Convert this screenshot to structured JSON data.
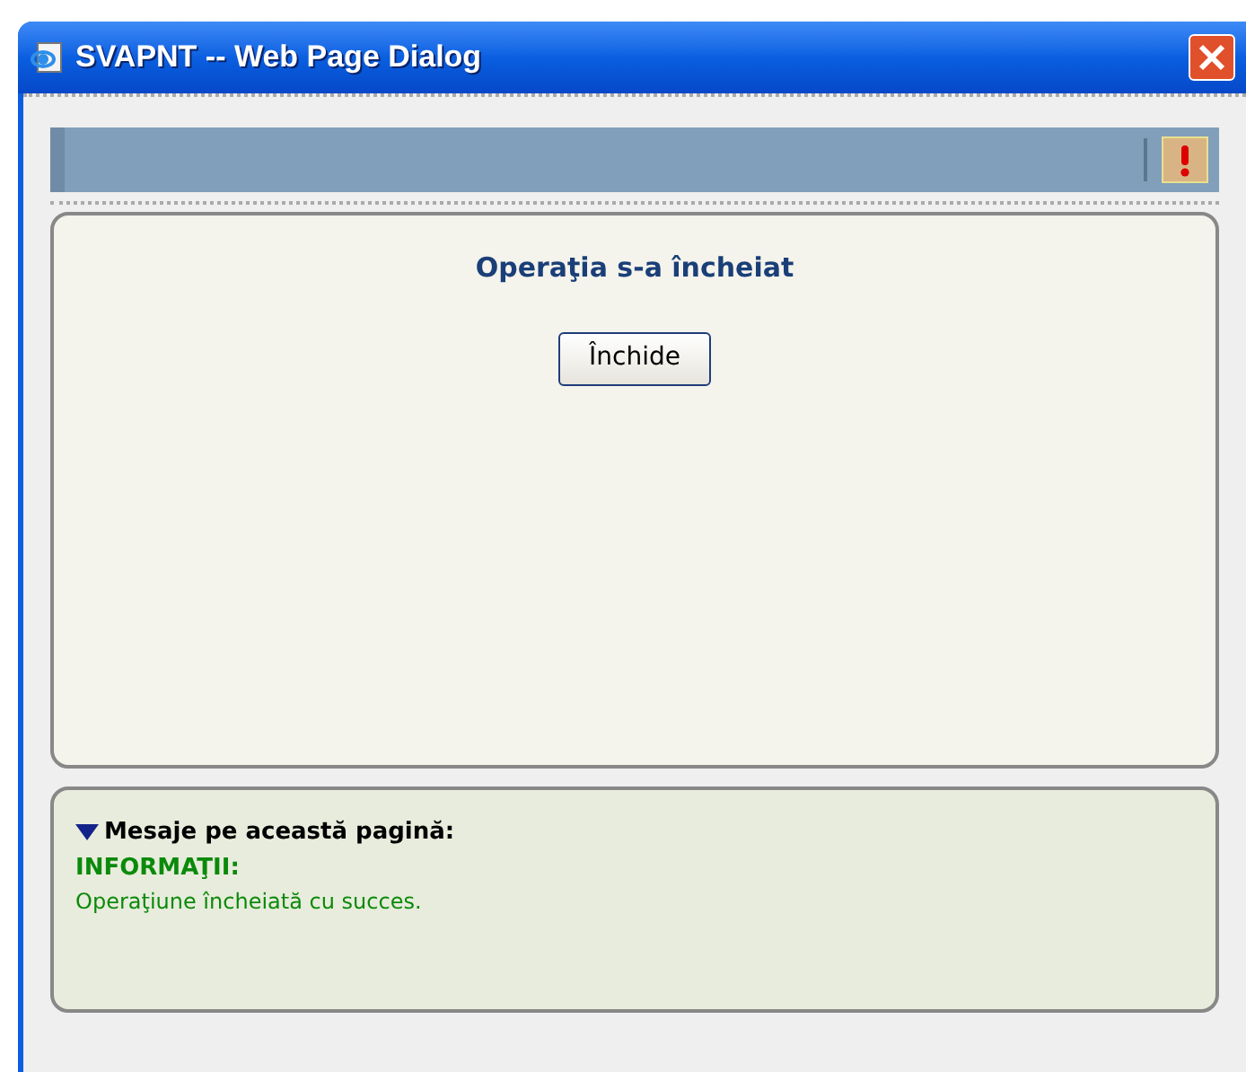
{
  "window": {
    "title": "SVAPNT -- Web Page Dialog"
  },
  "heading": "Operaţia s-a încheiat",
  "buttons": [
    "Închide"
  ],
  "messages": {
    "expanded": true,
    "title": "Mesaje pe această pagină:",
    "category": "INFORMAŢII:",
    "text": "Operaţiune încheiată cu succes."
  }
}
